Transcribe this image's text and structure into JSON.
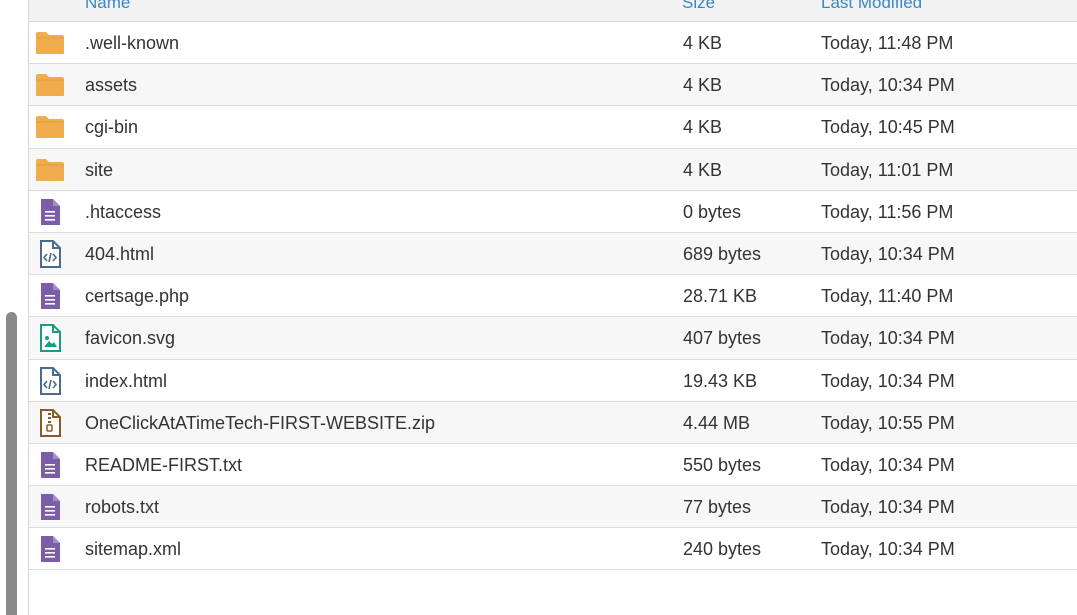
{
  "table": {
    "headers": {
      "name": "Name",
      "size": "Size",
      "modified": "Last Modified"
    },
    "rows": [
      {
        "name": ".well-known",
        "size": "4 KB",
        "modified": "Today, 11:48 PM",
        "icon": "folder-icon"
      },
      {
        "name": "assets",
        "size": "4 KB",
        "modified": "Today, 10:34 PM",
        "icon": "folder-icon"
      },
      {
        "name": "cgi-bin",
        "size": "4 KB",
        "modified": "Today, 10:45 PM",
        "icon": "folder-icon"
      },
      {
        "name": "site",
        "size": "4 KB",
        "modified": "Today, 11:01 PM",
        "icon": "folder-icon"
      },
      {
        "name": ".htaccess",
        "size": "0 bytes",
        "modified": "Today, 11:56 PM",
        "icon": "text-file-icon"
      },
      {
        "name": "404.html",
        "size": "689 bytes",
        "modified": "Today, 10:34 PM",
        "icon": "code-file-icon"
      },
      {
        "name": "certsage.php",
        "size": "28.71 KB",
        "modified": "Today, 11:40 PM",
        "icon": "text-file-icon"
      },
      {
        "name": "favicon.svg",
        "size": "407 bytes",
        "modified": "Today, 10:34 PM",
        "icon": "image-file-icon"
      },
      {
        "name": "index.html",
        "size": "19.43 KB",
        "modified": "Today, 10:34 PM",
        "icon": "code-file-icon"
      },
      {
        "name": "OneClickAtATimeTech-FIRST-WEBSITE.zip",
        "size": "4.44 MB",
        "modified": "Today, 10:55 PM",
        "icon": "zip-file-icon"
      },
      {
        "name": "README-FIRST.txt",
        "size": "550 bytes",
        "modified": "Today, 10:34 PM",
        "icon": "text-file-icon"
      },
      {
        "name": "robots.txt",
        "size": "77 bytes",
        "modified": "Today, 10:34 PM",
        "icon": "text-file-icon"
      },
      {
        "name": "sitemap.xml",
        "size": "240 bytes",
        "modified": "Today, 10:34 PM",
        "icon": "text-file-icon"
      }
    ]
  },
  "colors": {
    "folder": "#f0ad4e",
    "text_file": "#7b5ea7",
    "code_file": "#4a6b8f",
    "image_file": "#1a9c84",
    "zip_file": "#8a5a2b",
    "header_link": "#3a87c8"
  }
}
